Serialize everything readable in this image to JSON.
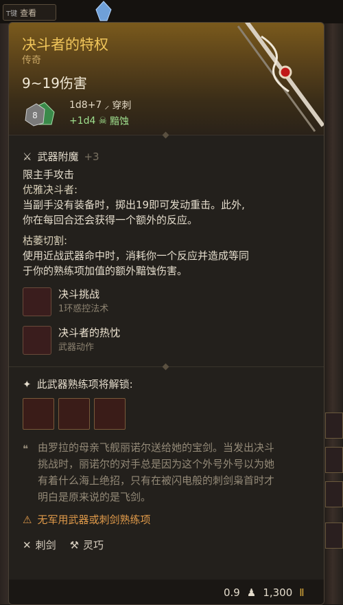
{
  "topbar": {
    "key_label": "T键",
    "view_label": "查看"
  },
  "item": {
    "name": "决斗者的特权",
    "rarity": "传奇",
    "damage": "9~19伤害",
    "die_face": "8",
    "damage_lines": [
      {
        "dice": "1d8+7",
        "type": "穿刺"
      },
      {
        "dice": "+1d4",
        "type": "黯蚀"
      }
    ]
  },
  "enchant": {
    "label": "武器附魔",
    "bonus": "+3"
  },
  "properties_text": {
    "main_hand": "限主手攻击",
    "elegant_head": "优雅决斗者:",
    "elegant_line1": "当副手没有装备时，掷出19即可发动重击。此外,",
    "elegant_line2": "你在每回合还会获得一个额外的反应。",
    "wither_head": "枯萎切割:",
    "wither_line1": "使用近战武器命中时，消耗你一个反应并造成等同",
    "wither_line2": "于你的熟练项加值的额外黯蚀伤害。"
  },
  "actions": [
    {
      "name": "决斗挑战",
      "sub": "1环惑控法术"
    },
    {
      "name": "决斗者的热忱",
      "sub": "武器动作"
    }
  ],
  "unlock": {
    "label": "此武器熟练项将解锁:"
  },
  "lore": {
    "l1": "由罗拉的母亲飞舰丽诺尔送给她的宝剑。当发出决斗",
    "l2": "挑战时，丽诺尔的对手总是因为这个外号外号以为她",
    "l3": "有着什么海上绝招，只有在被闪电般的刺剑枭首时才",
    "l4": "明白是原来说的是飞剑。"
  },
  "warning": "无军用武器或刺剑熟练项",
  "tags": [
    "刺剑",
    "灵巧"
  ],
  "footer": {
    "weight": "0.9",
    "price": "1,300"
  },
  "colors": {
    "title": "#f0c55a",
    "rarity": "#c4a363",
    "necrotic": "#9fe08e",
    "warning": "#e09a4a"
  }
}
